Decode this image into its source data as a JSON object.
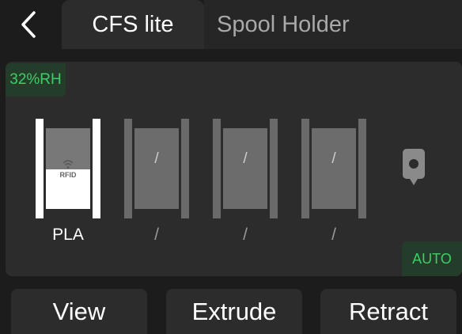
{
  "header": {
    "back_icon": "chevron-left-icon",
    "tabs": [
      {
        "label": "CFS lite",
        "active": true
      },
      {
        "label": "Spool Holder",
        "active": false
      }
    ]
  },
  "panel": {
    "humidity": "32%RH",
    "slots": [
      {
        "material": "PLA",
        "center_mark": "",
        "tag": "RFID",
        "loaded": true
      },
      {
        "material": "/",
        "center_mark": "/",
        "loaded": false
      },
      {
        "material": "/",
        "center_mark": "/",
        "loaded": false
      },
      {
        "material": "/",
        "center_mark": "/",
        "loaded": false
      }
    ],
    "nozzle_icon": "nozzle-icon",
    "auto_label": "AUTO"
  },
  "actions": {
    "view": "View",
    "extrude": "Extrude",
    "retract": "Retract"
  },
  "colors": {
    "accent_green": "#3fce66",
    "accent_bg": "#243d2a",
    "background": "#1c1c1c",
    "panel": "#2c2c2c"
  }
}
